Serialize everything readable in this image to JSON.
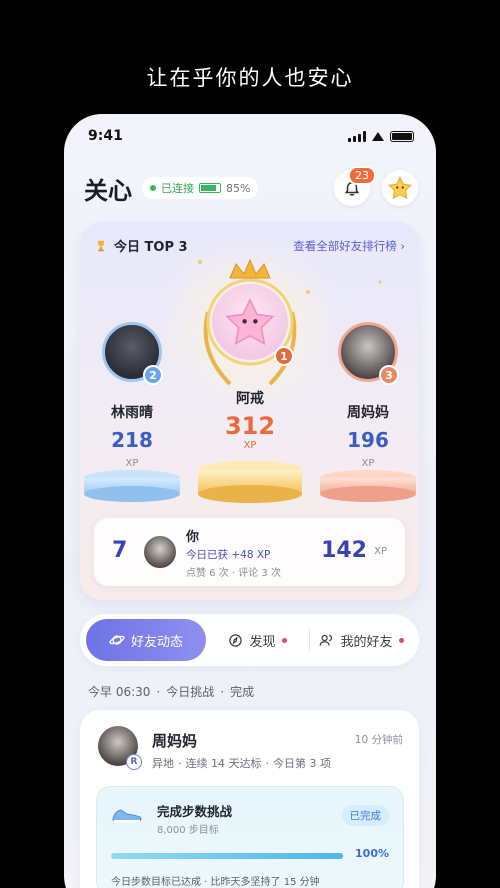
{
  "tagline": "让在乎你的人也安心",
  "status_bar": {
    "time": "9:41"
  },
  "header": {
    "title": "关心",
    "connection": {
      "label": "已连接",
      "battery": "85%"
    },
    "notifications_count": "23"
  },
  "leaderboard": {
    "title": "今日 TOP 3",
    "link": "查看全部好友排行榜",
    "link_chevron": "›",
    "podium": [
      {
        "rank": "2",
        "name": "林雨晴",
        "xp": "218",
        "xp_label": "XP"
      },
      {
        "rank": "1",
        "name": "阿戒",
        "xp": "312",
        "xp_label": "XP"
      },
      {
        "rank": "3",
        "name": "周妈妈",
        "xp": "196",
        "xp_label": "XP"
      }
    ],
    "me": {
      "rank": "7",
      "name": "你",
      "gain": "今日已获 +48 XP",
      "stats": "点赞 6 次 · 评论 3 次",
      "xp": "142",
      "xp_label": "XP"
    }
  },
  "tabs": [
    {
      "label": "好友动态",
      "active": true
    },
    {
      "label": "发现",
      "dot": true
    },
    {
      "label": "我的好友",
      "dot": true
    }
  ],
  "breadcrumb": [
    "今早 06:30",
    "·",
    "今日挑战",
    "·",
    "完成"
  ],
  "feed": {
    "name": "周妈妈",
    "badge": "R",
    "time": "10 分钟前",
    "meta": [
      "异地",
      "·",
      "连续 14 天达标",
      "·",
      "今日第 3 项"
    ],
    "challenge": {
      "title": "完成步数挑战",
      "goal": "8,000 步目标",
      "status": "已完成",
      "progress": 1.0,
      "progress_label": "100%",
      "note": "今日步数目标已达成 · 比昨天多坚持了 15 分钟"
    }
  },
  "colors": {
    "accent": "#6e74e6",
    "orange": "#f26b3a",
    "blue": "#3a43b5"
  }
}
